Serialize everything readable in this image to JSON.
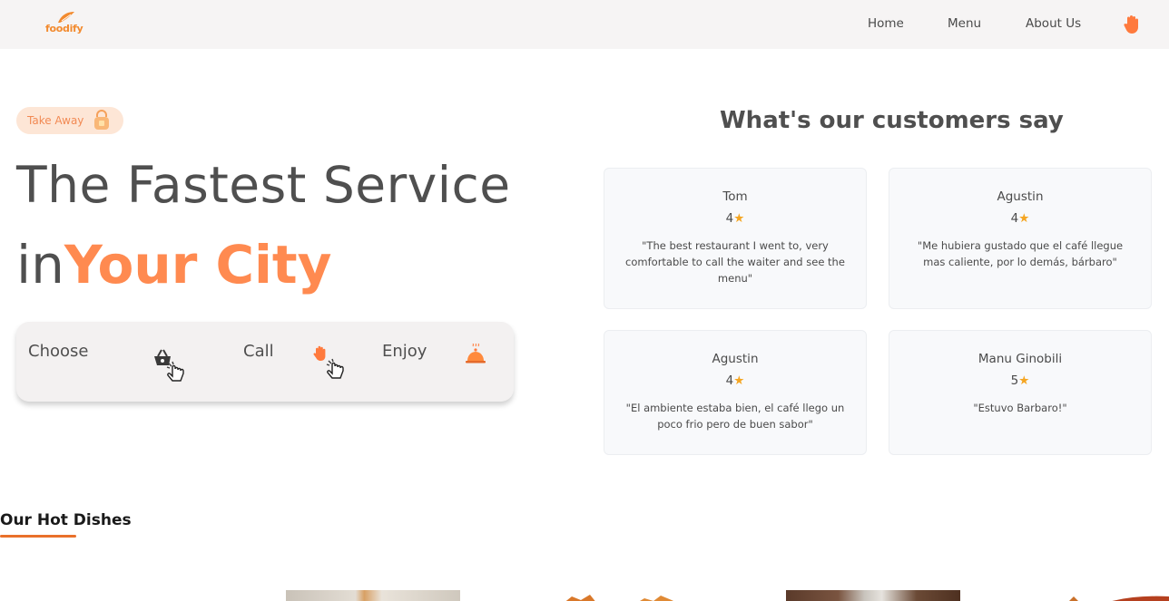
{
  "nav": {
    "logo_text": "foodify",
    "links": [
      "Home",
      "Menu",
      "About Us"
    ],
    "hand_icon": "hand-icon"
  },
  "hero": {
    "badge": "Take Away",
    "line1": "The Fastest Service",
    "line2_prefix": "in",
    "line2_highlight": "Your City",
    "steps": [
      "Choose",
      "Call",
      "Enjoy"
    ]
  },
  "reviews": {
    "title": "What's our customers say",
    "items": [
      {
        "name": "Tom",
        "rating": "4",
        "text": "\"The best restaurant I went to, very comfortable to call the waiter and see the menu\""
      },
      {
        "name": "Agustin",
        "rating": "4",
        "text": "\"Me hubiera gustado que el café llegue mas caliente, por lo demás, bárbaro\""
      },
      {
        "name": "Agustin",
        "rating": "4",
        "text": "\"El ambiente estaba bien, el café llego un poco frio pero de buen sabor\""
      },
      {
        "name": "Manu Ginobili",
        "rating": "5",
        "text": "\"Estuvo Barbaro!\""
      }
    ]
  },
  "dishes": {
    "title": "Our Hot Dishes"
  },
  "colors": {
    "accent": "#ff8a50",
    "badge_bg": "#fde6d6",
    "nav_bg": "#f6f4f4",
    "underline": "#e9702a",
    "star": "#f5a623"
  }
}
